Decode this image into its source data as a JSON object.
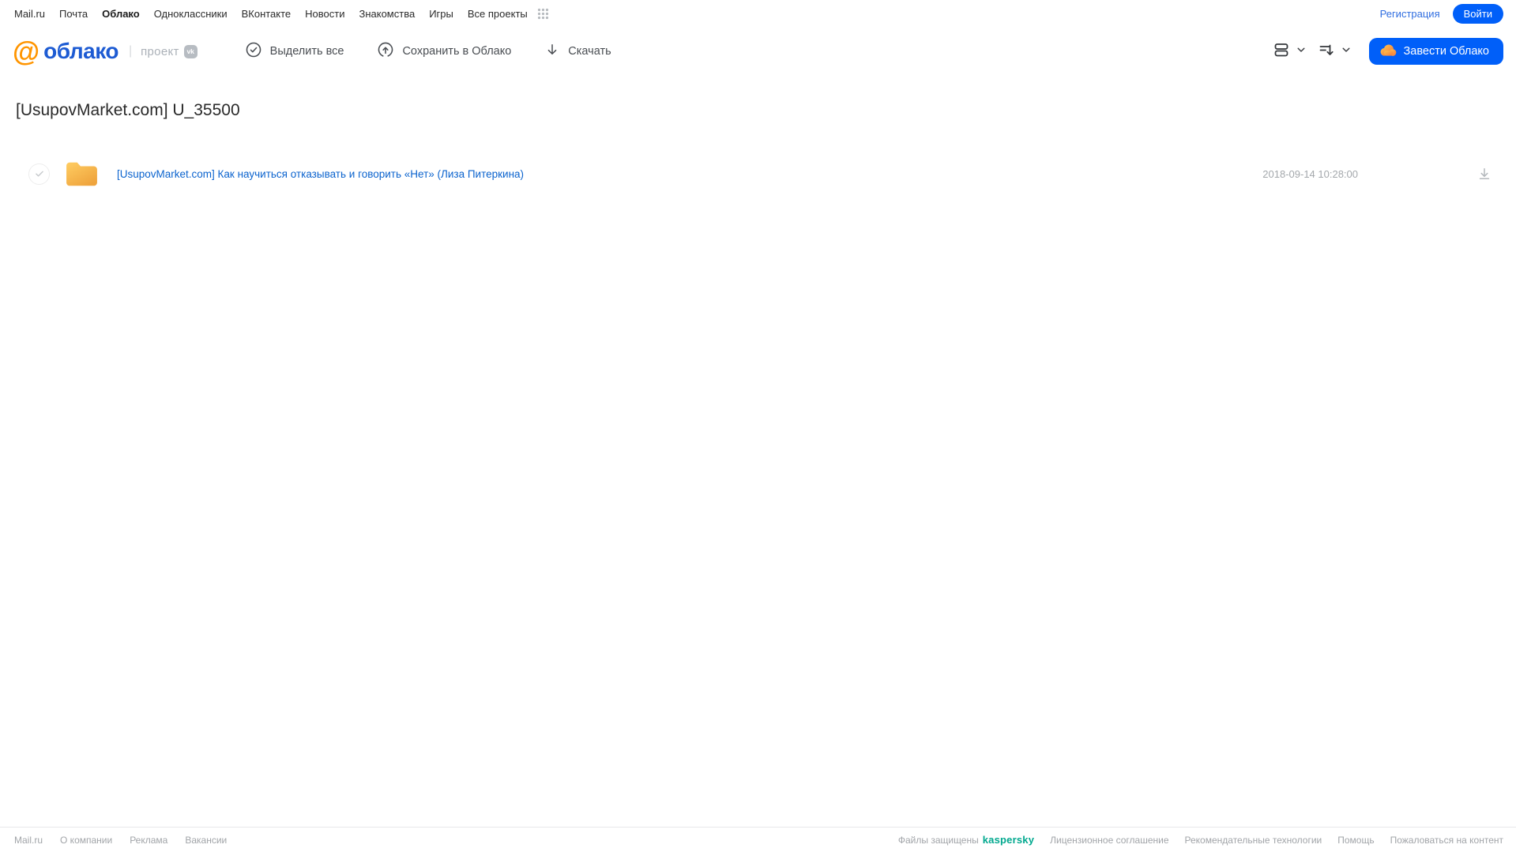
{
  "topnav": {
    "items": [
      "Mail.ru",
      "Почта",
      "Облако",
      "Одноклассники",
      "ВКонтакте",
      "Новости",
      "Знакомства",
      "Игры",
      "Все проекты"
    ],
    "registration": "Регистрация",
    "login": "Войти"
  },
  "header": {
    "logo_at": "@",
    "logo_text": "облако",
    "divider": "|",
    "project_label": "проект",
    "vk_badge": "vk",
    "toolbar": [
      {
        "label": "Выделить все",
        "icon": "check-circle-icon"
      },
      {
        "label": "Сохранить в Облако",
        "icon": "cloud-upload-icon"
      },
      {
        "label": "Скачать",
        "icon": "download-icon"
      }
    ],
    "get_cloud_button": "Завести Облако"
  },
  "main": {
    "title": "[UsupovMarket.com] U_35500",
    "files": [
      {
        "type": "folder",
        "name": "[UsupovMarket.com] Как научиться отказывать и говорить «Нет» (Лиза Питеркина)",
        "date": "2018-09-14 10:28:00"
      }
    ]
  },
  "footer": {
    "left_links": [
      "Mail.ru",
      "О компании",
      "Реклама",
      "Вакансии"
    ],
    "protected_label": "Файлы защищены",
    "kaspersky": "kaspersky",
    "right_links": [
      "Лицензионное соглашение",
      "Рекомендательные технологии",
      "Помощь",
      "Пожаловаться на контент"
    ]
  },
  "colors": {
    "accent_blue": "#005ff9",
    "logo_blue": "#1d5bd3",
    "brand_orange": "#ff9500",
    "folder_yellow": "#ffc95c",
    "kaspersky_teal": "#00a88e",
    "link_blue": "#0b63ce"
  }
}
